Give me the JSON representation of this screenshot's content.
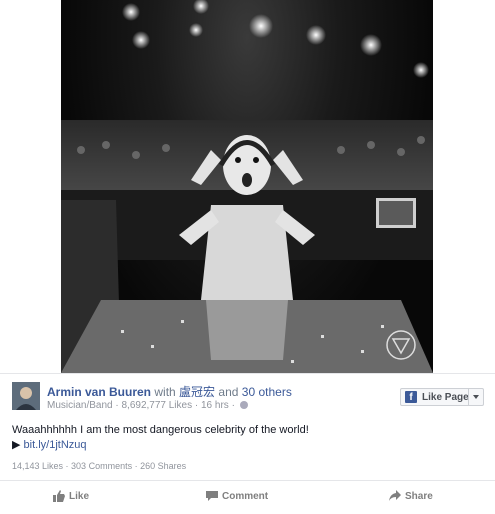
{
  "post": {
    "author": "Armin van Buuren",
    "with_word": "with",
    "tagged_person": "盧冠宏",
    "and_word": "and",
    "others": "30 others",
    "category": "Musician/Band",
    "likes_count": "8,692,777 Likes",
    "time": "16 hrs",
    "caption_text": "Waaahhhhhh I am the most dangerous celebrity of the world!",
    "link_text": "bit.ly/1jtNzuq",
    "stats": {
      "likes": "14,143 Likes",
      "comments": "303 Comments",
      "shares": "260 Shares"
    }
  },
  "like_page_button": {
    "label": "Like Page"
  },
  "actions": {
    "like": "Like",
    "comment": "Comment",
    "share": "Share"
  },
  "colors": {
    "link_blue": "#3b5998",
    "meta_gray": "#90949c",
    "action_gray": "#7f7f7f"
  },
  "icons": {
    "avatar": "avatar",
    "like_page": "facebook-f-icon",
    "privacy": "globe-icon",
    "like": "thumbs-up-icon",
    "comment": "speech-bubble-icon",
    "share": "share-arrow-icon"
  }
}
